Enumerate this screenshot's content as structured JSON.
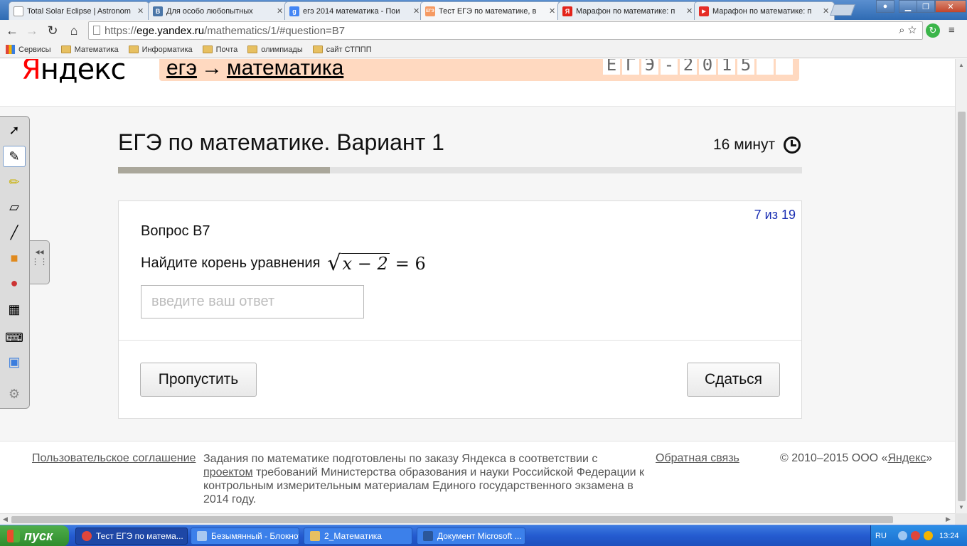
{
  "browser": {
    "tabs": [
      {
        "title": "Total Solar Eclipse | Astronom",
        "fav_color": "#ffffff",
        "fav_glyph": "",
        "active": false
      },
      {
        "title": "Для особо любопытных",
        "fav_color": "#4a76a8",
        "fav_glyph": "В",
        "active": false
      },
      {
        "title": "егэ 2014 математика - Пои",
        "fav_color": "#4285f4",
        "fav_glyph": "g",
        "active": false
      },
      {
        "title": "Тест ЕГЭ по математике, в",
        "fav_color": "#f59a63",
        "fav_glyph": "ЕГЭ",
        "active": true
      },
      {
        "title": "Марафон по математике: п",
        "fav_color": "#e3231a",
        "fav_glyph": "Я",
        "active": false
      },
      {
        "title": "Марафон по математике: п",
        "fav_color": "#e52d27",
        "fav_glyph": "▶",
        "active": false
      }
    ],
    "url_prefix": "https://",
    "url_domain": "ege.yandex.ru",
    "url_path": "/mathematics/1/#question=B7",
    "bookmarks": [
      {
        "label": "Сервисы",
        "type": "apps"
      },
      {
        "label": "Математика",
        "type": "folder"
      },
      {
        "label": "Информатика",
        "type": "folder"
      },
      {
        "label": "Почта",
        "type": "folder"
      },
      {
        "label": "олимпиады",
        "type": "folder"
      },
      {
        "label": "сайт СТППП",
        "type": "folder"
      }
    ]
  },
  "page": {
    "logo_first": "Я",
    "logo_rest": "ндекс",
    "breadcrumb": {
      "part1": "егэ",
      "arrow": "→",
      "part2": "математика"
    },
    "banner_cells": [
      "Е",
      "Г",
      "Э",
      "-",
      "2",
      "0",
      "1",
      "5",
      "",
      ""
    ],
    "test_title": "ЕГЭ по математике. Вариант 1",
    "timer": "16 минут",
    "progress_fraction": 0.31,
    "question": {
      "counter": "7 из 19",
      "label": "Вопрос B7",
      "text": "Найдите корень уравнения",
      "formula_radicand": "x − 2",
      "formula_rest": "= 6",
      "answer_value": "",
      "answer_placeholder": "введите ваш ответ",
      "skip_label": "Пропустить",
      "giveup_label": "Сдаться"
    },
    "footer": {
      "terms": "Пользовательское соглашение",
      "desc_before": "Задания по математике подготовлены по заказу Яндекса в соответствии с",
      "desc_link": "проектом",
      "desc_after": "требований Министерства образования и науки Российской Федерации к контрольным измерительным материалам Единого государственного экзамена в 2014 году.",
      "feedback": "Обратная связь",
      "copy_before": "© 2010–2015  ООО «",
      "copy_link": "Яндекс",
      "copy_after": "»"
    }
  },
  "taskbar": {
    "start_label": "пуск",
    "tasks": [
      {
        "label": "Тест ЕГЭ по матема...",
        "active": true,
        "icon_color": "#e0463b"
      },
      {
        "label": "Безымянный - Блокнот",
        "active": false,
        "icon_color": "#a8c8f0"
      },
      {
        "label": "2_Математика",
        "active": false,
        "icon_color": "#e7c061"
      },
      {
        "label": "Документ Microsoft ...",
        "active": false,
        "icon_color": "#2b579a"
      }
    ],
    "lang": "RU",
    "time": "13:24"
  }
}
